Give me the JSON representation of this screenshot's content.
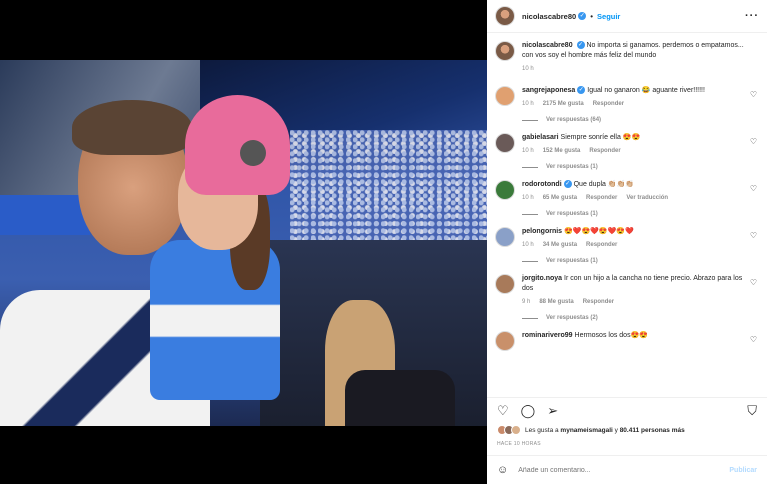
{
  "post": {
    "username": "nicolascabre80",
    "follow_label": "Seguir",
    "separator": "•"
  },
  "caption": {
    "username": "nicolascabre80",
    "text": "No importa si ganamos. perdemos o empatamos... con vos soy el hombre más feliz del mundo",
    "time": "10 h"
  },
  "comments": [
    {
      "username": "sangrejaponesa",
      "verified": true,
      "text": "Igual no ganaron 😂 aguante river!!!!!!",
      "time": "10 h",
      "likes": "2175 Me gusta",
      "reply": "Responder",
      "translate": "",
      "replies": "Ver respuestas (64)"
    },
    {
      "username": "gabielasari",
      "verified": false,
      "text": "Siempre sonríe ella 😍😍",
      "time": "10 h",
      "likes": "152 Me gusta",
      "reply": "Responder",
      "translate": "",
      "replies": "Ver respuestas (1)"
    },
    {
      "username": "rodorotondi",
      "verified": true,
      "text": "Que dupla 👏🏼👏🏼👏🏼",
      "time": "10 h",
      "likes": "65 Me gusta",
      "reply": "Responder",
      "translate": "Ver traducción",
      "replies": "Ver respuestas (1)"
    },
    {
      "username": "pelongornis",
      "verified": false,
      "text": "😍❤️😍❤️😍❤️😍❤️",
      "time": "10 h",
      "likes": "34 Me gusta",
      "reply": "Responder",
      "translate": "",
      "replies": "Ver respuestas (1)"
    },
    {
      "username": "jorgito.noya",
      "verified": false,
      "text": "Ir con un hijo a la cancha no tiene precio. Abrazo para los dos",
      "time": "9 h",
      "likes": "88 Me gusta",
      "reply": "Responder",
      "translate": "",
      "replies": "Ver respuestas (2)"
    },
    {
      "username": "rominarivero99",
      "verified": false,
      "text": "Hermosos los dos😍😍",
      "time": "",
      "likes": "",
      "reply": "",
      "translate": "",
      "replies": ""
    }
  ],
  "likes": {
    "prefix": "Les gusta a",
    "user": "mynameismagali",
    "middle": "y",
    "count": "80.411 personas más"
  },
  "timestamp": "HACE 10 HORAS",
  "add_comment": {
    "placeholder": "Añade un comentario...",
    "publish": "Publicar"
  },
  "icons": {
    "more": "more-icon",
    "like": "heart-icon",
    "comment": "comment-icon",
    "share": "share-icon",
    "save": "bookmark-icon",
    "emoji": "emoji-icon"
  },
  "colors": {
    "accent": "#0095f6",
    "verified": "#3897f0",
    "muted": "#8e8e8e"
  }
}
